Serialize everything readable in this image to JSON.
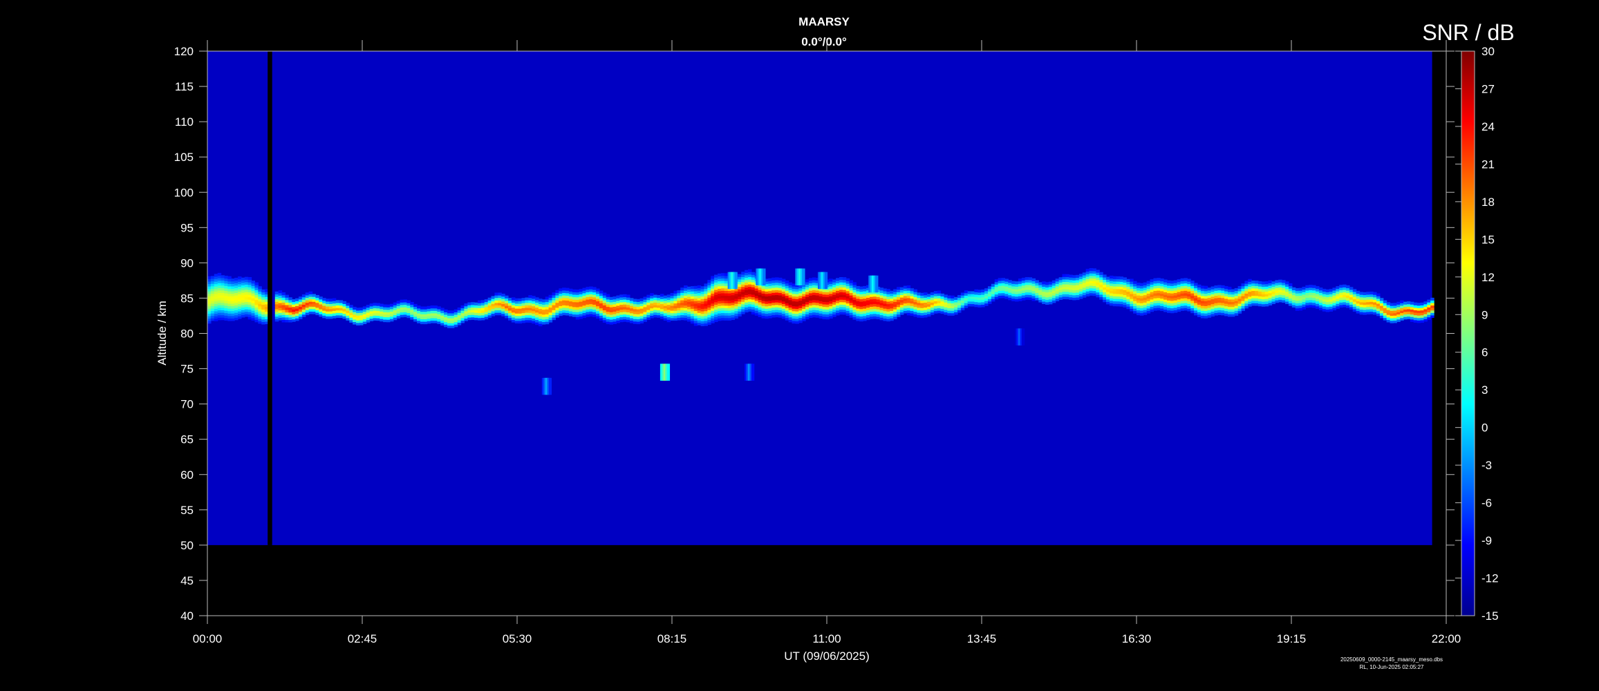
{
  "chart_data": {
    "type": "heatmap",
    "title": "MAARSY",
    "subtitle": "0.0°/0.0°",
    "xlabel": "UT (09/06/2025)",
    "ylabel": "Altitude / km",
    "x_ticks": [
      "00:00",
      "02:45",
      "05:30",
      "08:15",
      "11:00",
      "13:45",
      "16:30",
      "19:15",
      "22:00"
    ],
    "x_range_hours": [
      0,
      22
    ],
    "y_ticks": [
      40,
      45,
      50,
      55,
      60,
      65,
      70,
      75,
      80,
      85,
      90,
      95,
      100,
      105,
      110,
      115,
      120
    ],
    "ylim": [
      40,
      120
    ],
    "data_altitude_range_km": [
      50,
      120
    ],
    "data_time_range_hours": [
      0,
      21.75
    ],
    "data_gap_hours": [
      1.07,
      1.15
    ],
    "background_snr_db": -12,
    "colorbar": {
      "label": "SNR / dB",
      "range": [
        -15,
        30
      ],
      "ticks": [
        30,
        27,
        24,
        21,
        18,
        15,
        12,
        9,
        6,
        3,
        0,
        -3,
        -6,
        -9,
        -12,
        -15
      ],
      "colormap": "jet"
    },
    "echo_layer": [
      {
        "t": 0.0,
        "center_km": 84.5,
        "width_km": 5.5,
        "peak_snr": 12
      },
      {
        "t": 0.8,
        "center_km": 84.5,
        "width_km": 4.5,
        "peak_snr": 14
      },
      {
        "t": 1.5,
        "center_km": 83.5,
        "width_km": 2.5,
        "peak_snr": 24
      },
      {
        "t": 2.5,
        "center_km": 83.0,
        "width_km": 2.0,
        "peak_snr": 15
      },
      {
        "t": 3.5,
        "center_km": 82.5,
        "width_km": 2.0,
        "peak_snr": 9
      },
      {
        "t": 4.5,
        "center_km": 82.5,
        "width_km": 2.0,
        "peak_snr": 10
      },
      {
        "t": 5.3,
        "center_km": 83.5,
        "width_km": 2.5,
        "peak_snr": 20
      },
      {
        "t": 6.0,
        "center_km": 83.5,
        "width_km": 3.0,
        "peak_snr": 18
      },
      {
        "t": 7.0,
        "center_km": 84.0,
        "width_km": 3.0,
        "peak_snr": 22
      },
      {
        "t": 8.0,
        "center_km": 83.0,
        "width_km": 2.5,
        "peak_snr": 17
      },
      {
        "t": 9.0,
        "center_km": 85.0,
        "width_km": 5.0,
        "peak_snr": 26
      },
      {
        "t": 10.0,
        "center_km": 85.0,
        "width_km": 4.0,
        "peak_snr": 28
      },
      {
        "t": 11.0,
        "center_km": 84.5,
        "width_km": 4.0,
        "peak_snr": 27
      },
      {
        "t": 12.0,
        "center_km": 84.5,
        "width_km": 3.5,
        "peak_snr": 24
      },
      {
        "t": 12.8,
        "center_km": 83.5,
        "width_km": 2.5,
        "peak_snr": 18
      },
      {
        "t": 13.5,
        "center_km": 85.0,
        "width_km": 2.0,
        "peak_snr": 4
      },
      {
        "t": 14.5,
        "center_km": 86.0,
        "width_km": 2.5,
        "peak_snr": 9
      },
      {
        "t": 15.5,
        "center_km": 86.5,
        "width_km": 3.0,
        "peak_snr": 12
      },
      {
        "t": 16.5,
        "center_km": 85.5,
        "width_km": 3.5,
        "peak_snr": 18
      },
      {
        "t": 17.5,
        "center_km": 84.5,
        "width_km": 3.5,
        "peak_snr": 22
      },
      {
        "t": 18.5,
        "center_km": 85.0,
        "width_km": 3.0,
        "peak_snr": 18
      },
      {
        "t": 19.5,
        "center_km": 85.5,
        "width_km": 2.5,
        "peak_snr": 8
      },
      {
        "t": 20.5,
        "center_km": 84.0,
        "width_km": 2.5,
        "peak_snr": 17
      },
      {
        "t": 21.4,
        "center_km": 83.0,
        "width_km": 2.0,
        "peak_snr": 22
      }
    ],
    "bursts": [
      {
        "t": 9.3,
        "alt_km": 87.5,
        "peak_snr": 3
      },
      {
        "t": 9.8,
        "alt_km": 88.0,
        "peak_snr": 2
      },
      {
        "t": 10.5,
        "alt_km": 88.0,
        "peak_snr": 3
      },
      {
        "t": 10.9,
        "alt_km": 87.5,
        "peak_snr": 1
      },
      {
        "t": 11.8,
        "alt_km": 87.0,
        "peak_snr": 2
      },
      {
        "t": 6.0,
        "alt_km": 72.5,
        "peak_snr": -2
      },
      {
        "t": 8.1,
        "alt_km": 74.5,
        "peak_snr": 8
      },
      {
        "t": 9.6,
        "alt_km": 74.5,
        "peak_snr": -3
      },
      {
        "t": 14.4,
        "alt_km": 79.5,
        "peak_snr": -5
      }
    ]
  },
  "footer": {
    "filename": "20250609_0000-2145_maarsy_meso.dbs",
    "generated": "RL, 10-Jun-2025 02:05:27"
  }
}
